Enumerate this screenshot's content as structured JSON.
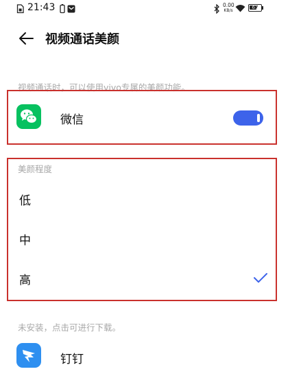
{
  "status_bar": {
    "time": "21:43",
    "net_speed_value": "0.00",
    "net_speed_unit": "KB/s",
    "battery": "67"
  },
  "header": {
    "title": "视频通话美颜"
  },
  "description": "视频通话时，可以使用vivo专属的美颜功能。",
  "installed_app": {
    "label": "微信",
    "enabled": true,
    "icon": "wechat-icon"
  },
  "beauty_level": {
    "section_title": "美颜程度",
    "options": [
      {
        "label": "低",
        "selected": false
      },
      {
        "label": "中",
        "selected": false
      },
      {
        "label": "高",
        "selected": true
      }
    ]
  },
  "uninstalled": {
    "hint": "未安装，点击可进行下载。",
    "apps": [
      {
        "label": "钉钉",
        "icon": "dingtalk-icon"
      }
    ]
  },
  "colors": {
    "accent": "#3d63ea",
    "highlight_border": "#c9302c",
    "wechat_green": "#07c160",
    "dingtalk_blue": "#2e8ff0"
  }
}
